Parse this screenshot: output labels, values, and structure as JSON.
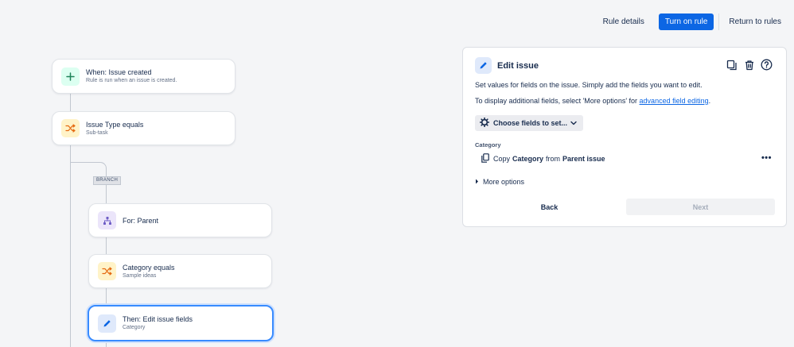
{
  "topbar": {
    "rule_details": "Rule details",
    "turn_on_rule": "Turn on rule",
    "return_to_rules": "Return to rules"
  },
  "flow": {
    "trigger": {
      "title": "When: Issue created",
      "subtitle": "Rule is run when an issue is created.",
      "icon": "plus-icon"
    },
    "condition1": {
      "title": "Issue Type equals",
      "subtitle": "Sub-task",
      "icon": "shuffle-icon"
    },
    "branch_label": "BRANCH",
    "branch_for": {
      "title": "For: Parent",
      "icon": "hierarchy-icon"
    },
    "condition2": {
      "title": "Category equals",
      "subtitle": "Sample ideas",
      "icon": "shuffle-icon"
    },
    "action": {
      "title": "Then: Edit issue fields",
      "subtitle": "Category",
      "icon": "pencil-icon"
    }
  },
  "panel": {
    "title": "Edit issue",
    "description": "Set values for fields on the issue. Simply add the fields you want to edit.",
    "additional_prefix": "To display additional fields, select 'More options' for ",
    "additional_link": "advanced field editing",
    "additional_suffix": ".",
    "choose_fields": "Choose fields to set...",
    "field_label": "Category",
    "copy_prefix": "Copy",
    "copy_field": "Category",
    "copy_from": "from",
    "copy_source": "Parent issue",
    "more_dots": "•••",
    "more_options": "More options",
    "back": "Back",
    "next": "Next"
  },
  "colors": {
    "primary": "#0c66e4",
    "selected_border": "#388bff",
    "green_icon": "#1f845a",
    "orange_icon": "#e56910",
    "purple_icon": "#6e5dc6"
  }
}
